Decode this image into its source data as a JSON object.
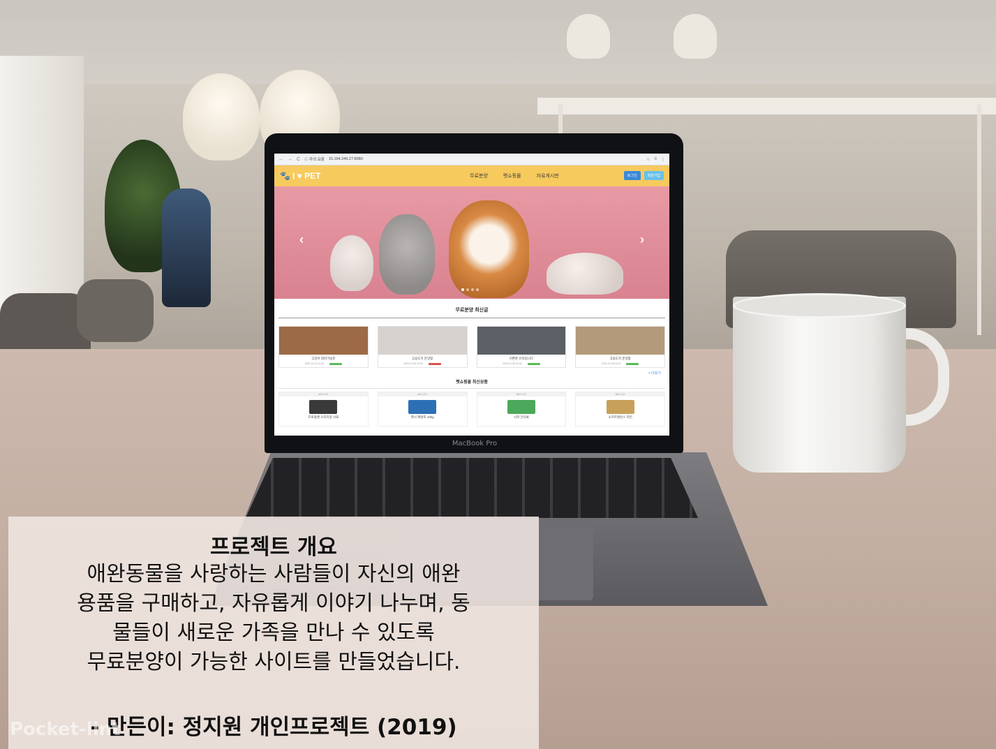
{
  "browser": {
    "nav_back": "←",
    "nav_forward": "→",
    "nav_reload": "C",
    "security": "ⓘ 주의 요함",
    "url": "15.164.246.27:8080",
    "tools": [
      "☆",
      "≡",
      "⋮"
    ]
  },
  "site": {
    "logo_text": "I ♥ PET",
    "menu": [
      "무료분양",
      "펫쇼핑몰",
      "자유게시판"
    ],
    "login_label": "로그인",
    "join_label": "회원가입",
    "carousel_prev": "‹",
    "carousel_next": "›",
    "adoption_section_title": "무료분양 최신글",
    "adoption_cards": [
      {
        "title": "고양이 데려가실분",
        "date": "2020-01-10 11:26",
        "badge_color": "#5cb85c",
        "thumb_color": "#9c6a46"
      },
      {
        "title": "고슴도치 분양합",
        "date": "2020-01-08 09:32",
        "badge_color": "#d9534f",
        "thumb_color": "#d7d2cf"
      },
      {
        "title": "이쁜준 유리입니다",
        "date": "2020-01-08 05:30",
        "badge_color": "#5cb85c",
        "thumb_color": "#5d5f66"
      },
      {
        "title": "고슴도치 분양합",
        "date": "2020-01-08 03:20",
        "badge_color": "#5cb85c",
        "thumb_color": "#b39a7a"
      }
    ],
    "more_label": "+ 더보기",
    "shop_section_title": "펫쇼핑몰 최신상품",
    "products": [
      {
        "price": "₩00,000",
        "name": "프로플랜 오리지널 사료",
        "img_color": "#3a3a3a"
      },
      {
        "price": "₩00,000",
        "name": "캣시 캐럿토 10kg",
        "img_color": "#2c6fb5"
      },
      {
        "price": "₩00,000",
        "name": "시저 간식류",
        "img_color": "#4ca85a"
      },
      {
        "price": "₩00,000",
        "name": "소프트발린스 치킨",
        "img_color": "#c7a15a"
      }
    ]
  },
  "laptop": {
    "brand": "MacBook Pro"
  },
  "caption": {
    "title": "프로젝트 개요",
    "lines": [
      "애완동물을 사랑하는 사람들이 자신의 애완",
      "용품을 구매하고, 자유롭게 이야기 나누며, 동",
      "물들이 새로운 가족을 만나 수 있도록",
      "무료분양이 가능한 사이트를 만들었습니다."
    ],
    "credit": "- 만든이: 정지원 개인프로젝트 (2019)"
  },
  "watermark": "Pocket-lint",
  "colors": {
    "nav_bg": "#f7ca5e",
    "accent_blue": "#3c89d9",
    "caption_bg": "#f0e6e1"
  }
}
